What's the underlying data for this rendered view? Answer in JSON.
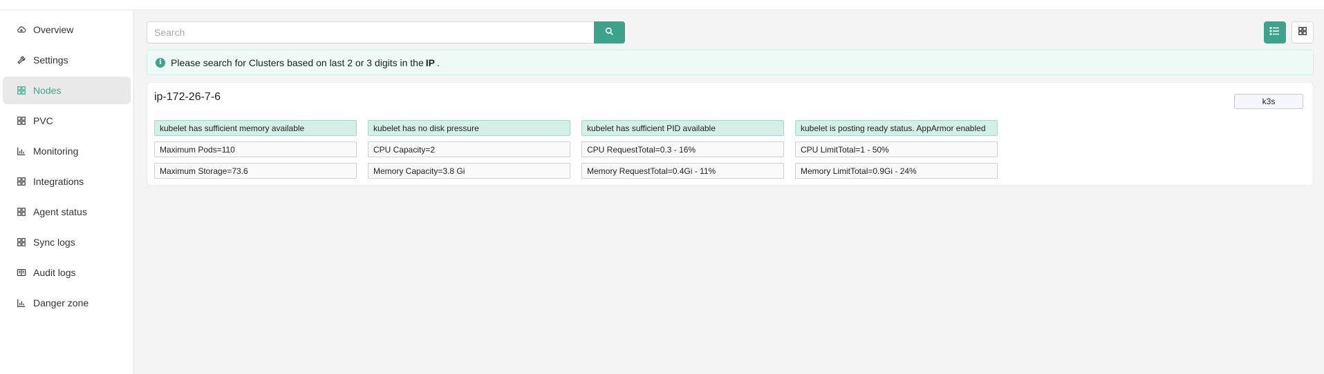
{
  "sidebar": {
    "items": [
      {
        "label": "Overview",
        "icon": "cloud-icon"
      },
      {
        "label": "Settings",
        "icon": "wrench-icon"
      },
      {
        "label": "Nodes",
        "icon": "grid-icon",
        "active": true
      },
      {
        "label": "PVC",
        "icon": "grid-icon"
      },
      {
        "label": "Monitoring",
        "icon": "bar-chart-icon"
      },
      {
        "label": "Integrations",
        "icon": "grid-icon"
      },
      {
        "label": "Agent status",
        "icon": "grid-icon"
      },
      {
        "label": "Sync logs",
        "icon": "grid-icon"
      },
      {
        "label": "Audit logs",
        "icon": "book-icon"
      },
      {
        "label": "Danger zone",
        "icon": "bar-chart-icon"
      }
    ]
  },
  "search": {
    "placeholder": "Search",
    "value": ""
  },
  "info": {
    "text_before": "Please search for Clusters based on last 2 or 3 digits in the",
    "bold": "IP",
    "text_after": "."
  },
  "node": {
    "name": "ip-172-26-7-6",
    "badge": "k3s",
    "conditions": [
      "kubelet has sufficient memory available",
      "kubelet has no disk pressure",
      "kubelet has sufficient PID available",
      "kubelet is posting ready status. AppArmor enabled"
    ],
    "row2": [
      "Maximum Pods=110",
      "CPU Capacity=2",
      "CPU RequestTotal=0.3 - 16%",
      "CPU LimitTotal=1 - 50%"
    ],
    "row3": [
      "Maximum Storage=73.6",
      "Memory Capacity=3.8 Gi",
      "Memory RequestTotal=0.4Gi - 11%",
      "Memory LimitTotal=0.9Gi - 24%"
    ]
  },
  "colors": {
    "accent": "#3da38a",
    "active_nav_text": "#3daa8c",
    "status_cell_bg": "#d4efe6",
    "info_bg": "#edfaf6"
  }
}
